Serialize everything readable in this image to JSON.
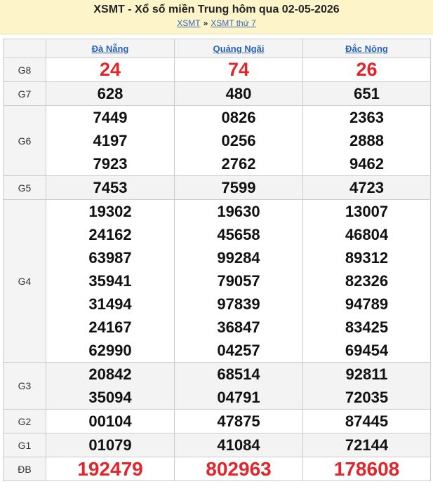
{
  "header": {
    "title": "XSMT - Xổ số miền Trung hôm qua 02-05-2026",
    "crumb1": "XSMT",
    "separator": "»",
    "crumb2": "XSMT thứ 7"
  },
  "provinces": [
    "Đà Nẵng",
    "Quảng Ngãi",
    "Đắc Nông"
  ],
  "results": [
    {
      "prize": "G8",
      "cols": [
        [
          "24"
        ],
        [
          "74"
        ],
        [
          "26"
        ]
      ]
    },
    {
      "prize": "G7",
      "cols": [
        [
          "628"
        ],
        [
          "480"
        ],
        [
          "651"
        ]
      ]
    },
    {
      "prize": "G6",
      "cols": [
        [
          "7449",
          "4197",
          "7923"
        ],
        [
          "0826",
          "0256",
          "2762"
        ],
        [
          "2363",
          "2888",
          "9462"
        ]
      ]
    },
    {
      "prize": "G5",
      "cols": [
        [
          "7453"
        ],
        [
          "7599"
        ],
        [
          "4723"
        ]
      ]
    },
    {
      "prize": "G4",
      "cols": [
        [
          "19302",
          "24162",
          "63987",
          "35941",
          "31494",
          "24167",
          "62990"
        ],
        [
          "19630",
          "45658",
          "99284",
          "79057",
          "97839",
          "36847",
          "04257"
        ],
        [
          "13007",
          "46804",
          "89312",
          "82326",
          "94789",
          "83425",
          "69454"
        ]
      ]
    },
    {
      "prize": "G3",
      "cols": [
        [
          "20842",
          "35094"
        ],
        [
          "68514",
          "04791"
        ],
        [
          "92811",
          "72035"
        ]
      ]
    },
    {
      "prize": "G2",
      "cols": [
        [
          "00104"
        ],
        [
          "47875"
        ],
        [
          "87445"
        ]
      ]
    },
    {
      "prize": "G1",
      "cols": [
        [
          "01079"
        ],
        [
          "41084"
        ],
        [
          "72144"
        ]
      ]
    },
    {
      "prize": "ĐB",
      "cols": [
        [
          "192479"
        ],
        [
          "802963"
        ],
        [
          "178608"
        ]
      ]
    }
  ],
  "colors": {
    "header_bg": "#fdf4c9",
    "link": "#2b62b3",
    "highlight_red": "#e3242b"
  }
}
